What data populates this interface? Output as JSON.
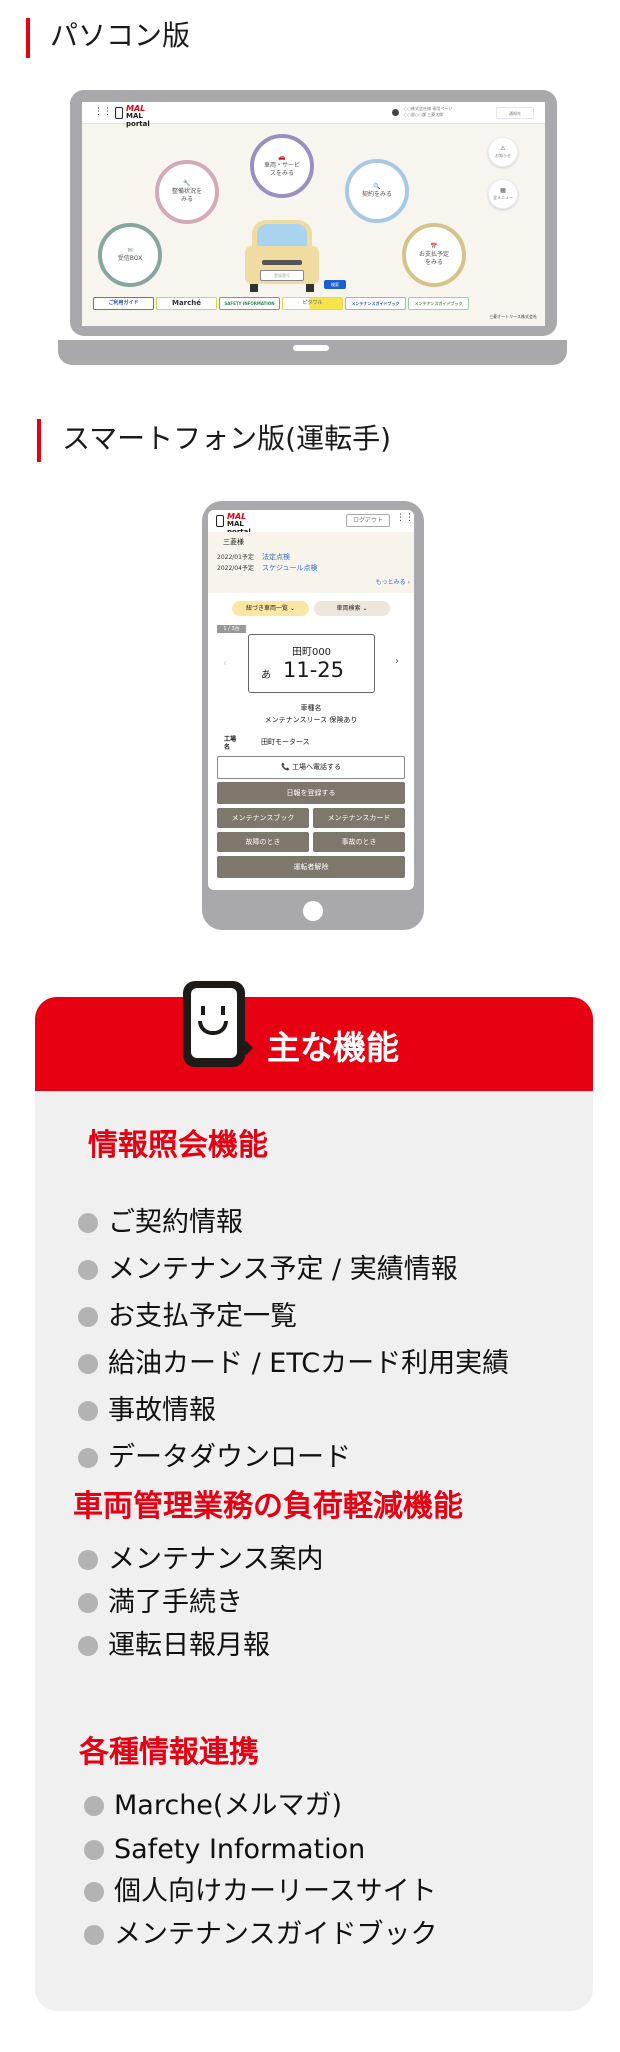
{
  "headings": {
    "pc": "パソコン版",
    "smartphone": "スマートフォン版(運転手)"
  },
  "pc": {
    "logo": "MAL portal",
    "user_line1": "○○株式会社様 専用ページ",
    "user_line2": "○○部○○課 三菱太郎",
    "header_button": "通知先",
    "circles": {
      "vehicle": "車両・サービスをみる",
      "maintenance": "整備状況をみる",
      "contract": "契約をみる",
      "inbox": "受信BOX",
      "payment": "お支払予定をみる"
    },
    "side": {
      "notice": "お知らせ",
      "menu": "全メニュー"
    },
    "plate_placeholder": "登録番号",
    "search_button": "検索",
    "banners": [
      "ご利用ガイド",
      "Marché",
      "SAFETY INFORMATION",
      "ピタワル",
      "メンテナンスガイドブック",
      "メンテナンスガイドブック"
    ],
    "footer": "三菱オートリース株式会社"
  },
  "sp": {
    "logo": "MAL portal",
    "logout": "ログアウト",
    "customer": "三菱様",
    "schedule": [
      {
        "date": "2022/01予定",
        "label": "法定点検"
      },
      {
        "date": "2022/04予定",
        "label": "スケジュール点検"
      }
    ],
    "more": "もっとみる",
    "linked_vehicles": "紐づき車両一覧",
    "vehicle_search": "車両検索",
    "counter": "1 / 3台",
    "plate_region": "田町000",
    "plate_kana": "あ",
    "plate_number": "11-25",
    "car_model": "車種名",
    "contract_type": "メンテナンスリース 保険あり",
    "factory_label": "工場名",
    "factory_name": "田町モータース",
    "call_button": "工場へ電話する",
    "daily_report": "日報を登録する",
    "maintenance_book": "メンテナンスブック",
    "maintenance_card": "メンテナンスカード",
    "breakdown": "故障のとき",
    "accident": "事故のとき",
    "release_driver": "運転者解除"
  },
  "features": {
    "title": "主な機能",
    "accent_color": "#e60012",
    "sections": [
      {
        "title": "情報照会機能",
        "items": [
          "ご契約情報",
          "メンテナンス予定 / 実績情報",
          "お支払予定一覧",
          "給油カード / ETCカード利用実績",
          "事故情報",
          "データダウンロード"
        ]
      },
      {
        "title": "車両管理業務の負荷軽減機能",
        "items": [
          "メンテナンス案内",
          "満了手続き",
          "運転日報月報"
        ]
      },
      {
        "title": "各種情報連携",
        "items": [
          "Marche(メルマガ)",
          "Safety Information",
          "個人向けカーリースサイト",
          "メンテナンスガイドブック"
        ]
      }
    ]
  }
}
